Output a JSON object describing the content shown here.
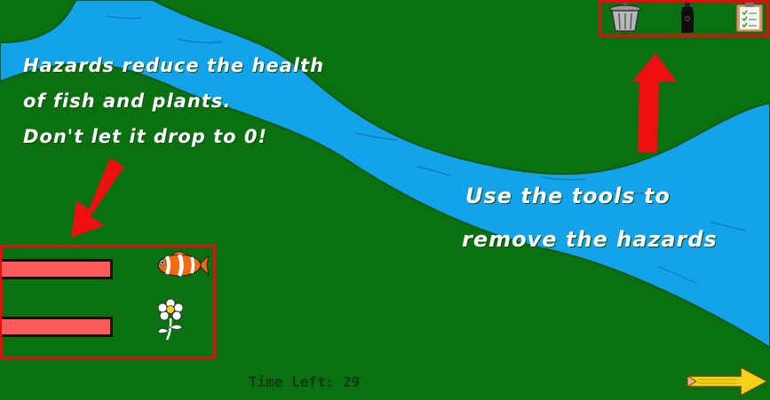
{
  "instructions": {
    "health_line1": "Hazards reduce the health",
    "health_line2": "of fish and plants.",
    "health_line3": "Don't let it drop to 0!",
    "tools_line1": "Use the tools to",
    "tools_line2": "remove the hazards"
  },
  "toolbar": {
    "tools": [
      {
        "icon": "trash-can-icon"
      },
      {
        "icon": "spray-bottle-icon"
      },
      {
        "icon": "clipboard-icon"
      }
    ]
  },
  "health": {
    "fish_level": 1.0,
    "plant_level": 1.0,
    "fish_icon": "clownfish-icon",
    "plant_icon": "flower-icon"
  },
  "timer": {
    "label": "Time Left:",
    "value": "29"
  },
  "navigation": {
    "next_icon": "pencil-arrow-right-icon"
  },
  "colors": {
    "grass": "#0a7110",
    "river": "#12a3ea",
    "highlight_red": "#e30d0d",
    "health_fill": "#ff5b5b"
  }
}
